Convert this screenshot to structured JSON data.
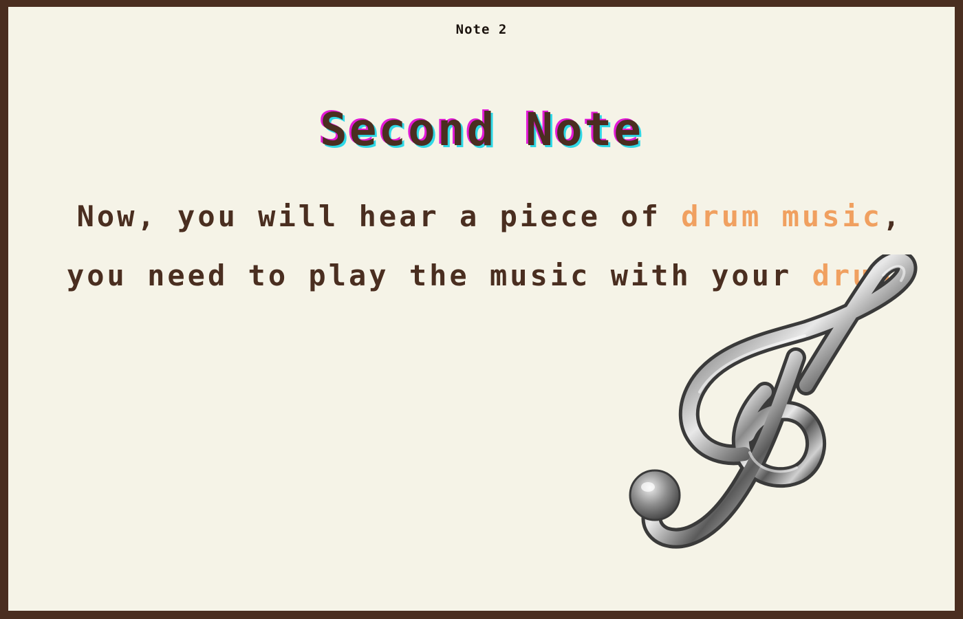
{
  "header": {
    "note_label": "Note 2"
  },
  "title": "Second Note",
  "message": {
    "part1": "Now, you will hear a piece of ",
    "highlight1": "drum music",
    "part2": ", you need to play the music with your ",
    "highlight2": "drum",
    "part3": "."
  },
  "colors": {
    "border": "#4a2e20",
    "background": "#f5f3e7",
    "text": "#4a2e20",
    "highlight": "#f0a060",
    "title_shadow_magenta": "#e21ad6",
    "title_shadow_cyan": "#2fd8e6"
  },
  "decoration": {
    "icon": "treble-clef-icon"
  }
}
